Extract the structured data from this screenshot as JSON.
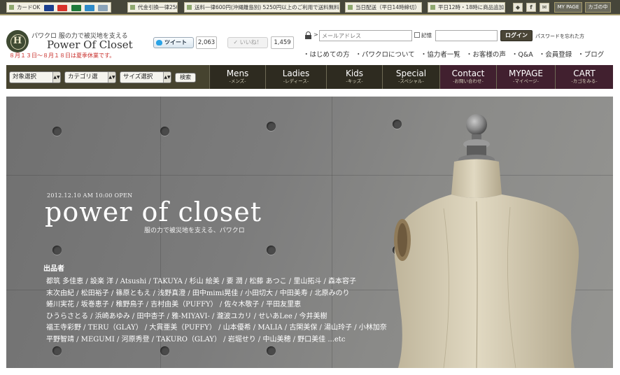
{
  "topbar": {
    "card_ok": "カードOK",
    "cards": [
      "VISA",
      "Master",
      "JCB",
      "AMEX",
      "Diners"
    ],
    "cod": "代金引換一律250円",
    "shipping": "送料一律600円(沖縄離島別) 5250円以上のご利用で送料無料",
    "sameday": "当日配送（平日14時締切）",
    "delivery": "平日12時・18時に商品追加",
    "icons": [
      "bird-icon",
      "facebook-icon",
      "mail-icon"
    ],
    "mypage_btn": "MY PAGE",
    "cart_btn": "カゴの中"
  },
  "logo": {
    "mark": "H",
    "subtitle": "パワクロ  服の力で被災地を支える",
    "name": "Power Of Closet",
    "holiday": "８月１３日～８月１８日は夏季休業です。"
  },
  "social": {
    "tweet_label": "ツイート",
    "tweet_count": "2,063",
    "like_label": "✓ いいね！",
    "like_count": "1,459"
  },
  "login": {
    "email_placeholder": "メールアドレス",
    "remember_label": "記憶",
    "login_button": "ログイン",
    "forgot_link": "パスワードを忘れた方"
  },
  "subnav": [
    "はじめての方",
    "パワクロについて",
    "協力者一覧",
    "お客様の声",
    "Q&A",
    "会員登録",
    "ブログ"
  ],
  "search": {
    "target": "対象選択",
    "category": "カテゴリ選",
    "size": "サイズ選択",
    "button": "検索"
  },
  "nav": [
    {
      "main": "Mens",
      "sub": "-メンズ-"
    },
    {
      "main": "Ladies",
      "sub": "-レディース-"
    },
    {
      "main": "Kids",
      "sub": "-キッズ-"
    },
    {
      "main": "Special",
      "sub": "-スペシャル-"
    },
    {
      "main": "Contact",
      "sub": "-お問い合わせ-"
    },
    {
      "main": "MYPAGE",
      "sub": "-マイページ-"
    },
    {
      "main": "CART",
      "sub": "-カゴをみる-"
    }
  ],
  "hero": {
    "date": "2012.12.10  AM  10:00  OPEN",
    "title": "power of closet",
    "tagline": "服の力で被災地を支える、パワクロ",
    "artists_label": "出品者",
    "artists_lines": [
      "都筑 多佳恵 / 設楽 洋 / Atsushi / TAKUYA / 杉山 絵美 / 要 潤 / 松藤 あつこ / 里山拓斗 / 森本容子",
      "末次由紀 / 松田裕子 / 篠原ともえ / 浅野真澄 / 田中mimi晃佳 / 小田切大 / 中田美寿 / 北原みのり",
      "蜷川実花 / 坂巻恵子 / 稚野鳥子 / 吉村由美（PUFFY） / 佐々木敬子 / 平田友里恵",
      "ひうらさとる / 浜崎あゆみ / 田中杏子 / 雅-MIYAVI- / 瀧波ユカリ / せいあLee / 今井美樹",
      "福王寺彩野 / TERU（GLAY） / 大貫亜美（PUFFY） / 山本優希 / MALIA / 古閑美保 / 湯山玲子 / 小林加奈",
      "平野智靖 / MEGUMI / 河原秀登 / TAKURO（GLAY） / 岩堀せり / 中山美穂 / 野口美佳 ...etc"
    ]
  }
}
